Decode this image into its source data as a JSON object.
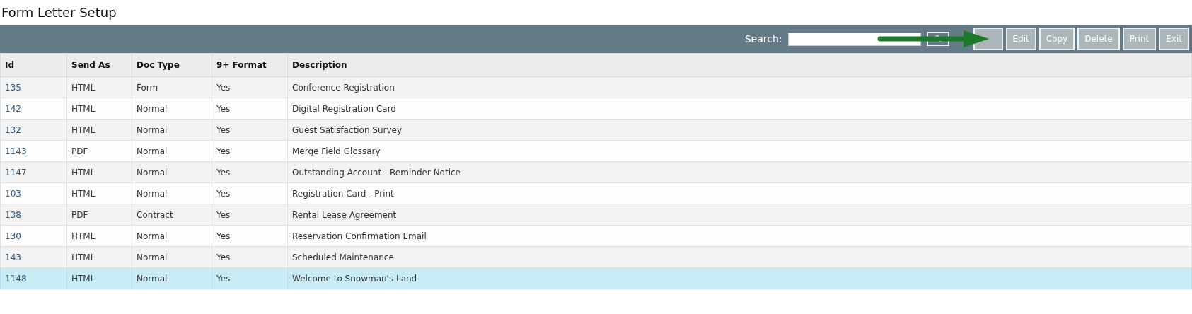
{
  "page_title": "Form Letter Setup",
  "toolbar": {
    "search_label": "Search:",
    "buttons": [
      "Edit",
      "Copy",
      "Delete",
      "Print",
      "Exit"
    ]
  },
  "table": {
    "columns": [
      "Id",
      "Send As",
      "Doc Type",
      "9+ Format",
      "Description"
    ],
    "rows": [
      {
        "cells": [
          "135",
          "HTML",
          "Form",
          "Yes",
          "Conference Registration"
        ],
        "selected": false
      },
      {
        "cells": [
          "142",
          "HTML",
          "Normal",
          "Yes",
          "Digital Registration Card"
        ],
        "selected": false
      },
      {
        "cells": [
          "132",
          "HTML",
          "Normal",
          "Yes",
          "Guest Satisfaction Survey"
        ],
        "selected": false
      },
      {
        "cells": [
          "1143",
          "PDF",
          "Normal",
          "Yes",
          "Merge Field Glossary"
        ],
        "selected": false
      },
      {
        "cells": [
          "1147",
          "HTML",
          "Normal",
          "Yes",
          "Outstanding Account - Reminder Notice"
        ],
        "selected": false
      },
      {
        "cells": [
          "103",
          "HTML",
          "Normal",
          "Yes",
          "Registration Card - Print"
        ],
        "selected": false
      },
      {
        "cells": [
          "138",
          "PDF",
          "Contract",
          "Yes",
          "Rental Lease Agreement"
        ],
        "selected": false
      },
      {
        "cells": [
          "130",
          "HTML",
          "Normal",
          "Yes",
          "Reservation Confirmation Email"
        ],
        "selected": false
      },
      {
        "cells": [
          "143",
          "HTML",
          "Normal",
          "Yes",
          "Scheduled Maintenance"
        ],
        "selected": false
      },
      {
        "cells": [
          "1148",
          "HTML",
          "Normal",
          "Yes",
          "Welcome to Snowman's Land"
        ],
        "selected": true
      }
    ]
  }
}
